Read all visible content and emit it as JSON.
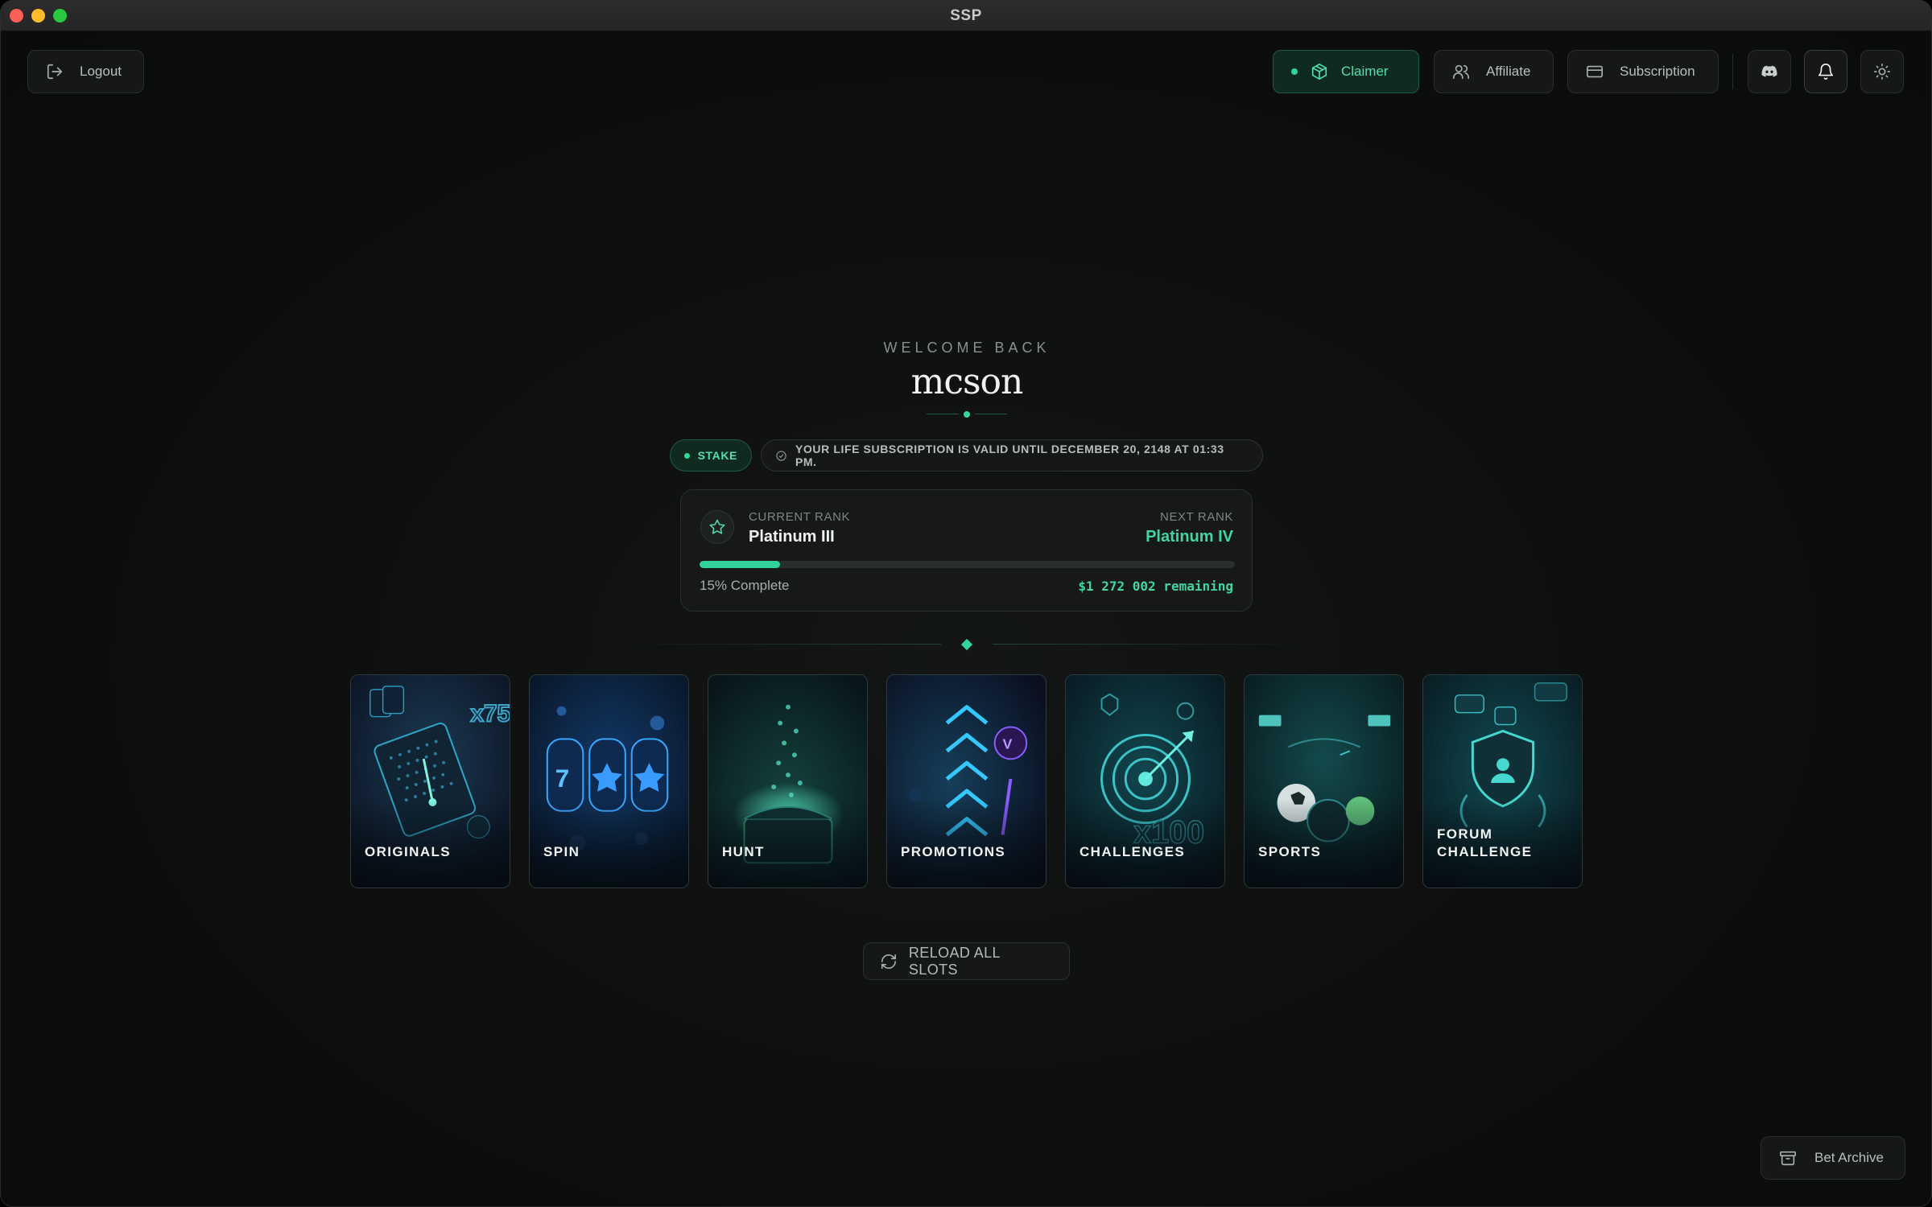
{
  "window": {
    "title": "SSP"
  },
  "header": {
    "logout_label": "Logout",
    "claimer_label": "Claimer",
    "affiliate_label": "Affiliate",
    "subscription_label": "Subscription"
  },
  "welcome": {
    "greeting": "WELCOME BACK",
    "username": "mcson"
  },
  "badges": {
    "platform": "STAKE",
    "subscription_notice": "YOUR LIFE SUBSCRIPTION IS VALID UNTIL DECEMBER 20, 2148 AT 01:33 PM."
  },
  "rank": {
    "current_label": "CURRENT RANK",
    "current_value": "Platinum III",
    "next_label": "NEXT RANK",
    "next_value": "Platinum IV",
    "progress_fraction": 0.15,
    "progress_text": "15% Complete",
    "remaining_text": "$1 272 002 remaining"
  },
  "cards": [
    {
      "label": "ORIGINALS"
    },
    {
      "label": "SPIN"
    },
    {
      "label": "HUNT"
    },
    {
      "label": "PROMOTIONS"
    },
    {
      "label": "CHALLENGES"
    },
    {
      "label": "SPORTS"
    },
    {
      "label": "FORUM CHALLENGE"
    }
  ],
  "actions": {
    "reload_label": "RELOAD ALL SLOTS",
    "archive_label": "Bet Archive"
  },
  "colors": {
    "accent": "#35d49a",
    "background": "#0d0f0e",
    "surface": "#161817"
  }
}
